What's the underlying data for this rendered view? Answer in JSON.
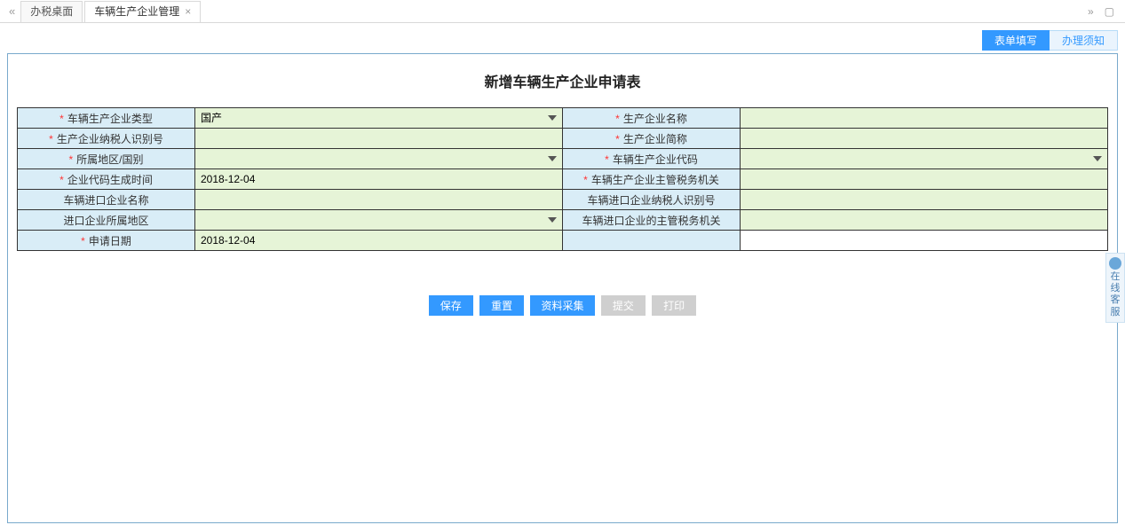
{
  "tabBar": {
    "navLeft": "«",
    "tab1": "办税桌面",
    "tab2": "车辆生产企业管理",
    "close": "×",
    "navRight": "»",
    "windowSquare": "▢"
  },
  "topActions": {
    "fill": "表单填写",
    "notice": "办理须知"
  },
  "formTitle": "新增车辆生产企业申请表",
  "labels": {
    "vehicleEnterpriseType": "车辆生产企业类型",
    "manufacturerName": "生产企业名称",
    "taxpayerId": "生产企业纳税人识别号",
    "manufacturerShort": "生产企业简称",
    "regionCountry": "所属地区/国别",
    "enterpriseCode": "车辆生产企业代码",
    "codeGenTime": "企业代码生成时间",
    "taxAuthority": "车辆生产企业主管税务机关",
    "importEnterpriseName": "车辆进口企业名称",
    "importTaxpayerId": "车辆进口企业纳税人识别号",
    "importRegion": "进口企业所属地区",
    "importTaxAuthority": "车辆进口企业的主管税务机关",
    "applyDate": "申请日期"
  },
  "required": true,
  "values": {
    "vehicleEnterpriseType": "国产",
    "manufacturerName": "",
    "taxpayerId": "",
    "manufacturerShort": "",
    "regionCountry": "",
    "enterpriseCode": "",
    "codeGenTime": "2018-12-04",
    "taxAuthority": "",
    "importEnterpriseName": "",
    "importTaxpayerId": "",
    "importRegion": "",
    "importTaxAuthority": "",
    "applyDate": "2018-12-04"
  },
  "buttons": {
    "save": "保存",
    "reset": "重置",
    "collect": "资料采集",
    "submit": "提交",
    "print": "打印"
  },
  "sideWidget": "在线客服",
  "reqMark": "*"
}
